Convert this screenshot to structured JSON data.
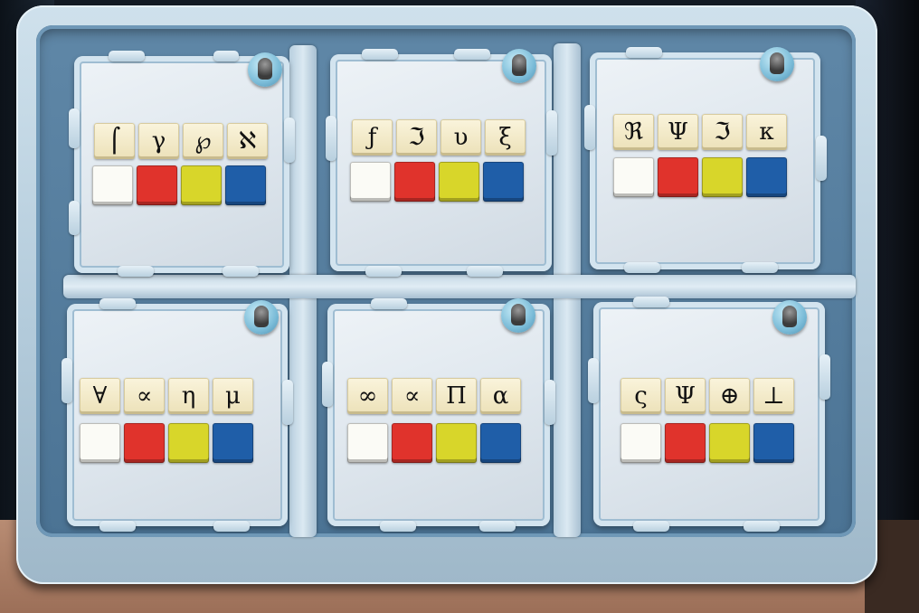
{
  "colors": {
    "white": "#fbfbf6",
    "red": "#e0332c",
    "yellow": "#d8d62a",
    "blue": "#1f5ea8"
  },
  "modules": [
    {
      "symbols": [
        "⌠",
        "γ",
        "℘",
        "ℵ"
      ]
    },
    {
      "symbols": [
        "ƒ",
        "ℑ",
        "υ",
        "ξ"
      ]
    },
    {
      "symbols": [
        "ℜ",
        "Ψ",
        "ℑ",
        "κ"
      ]
    },
    {
      "symbols": [
        "∀",
        "∝",
        "η",
        "μ"
      ]
    },
    {
      "symbols": [
        "∞",
        "∝",
        "Π",
        "α"
      ]
    },
    {
      "symbols": [
        "ς",
        "Ψ",
        "⊕",
        "⊥"
      ]
    }
  ],
  "color_buttons": [
    "white",
    "red",
    "yellow",
    "blue"
  ]
}
